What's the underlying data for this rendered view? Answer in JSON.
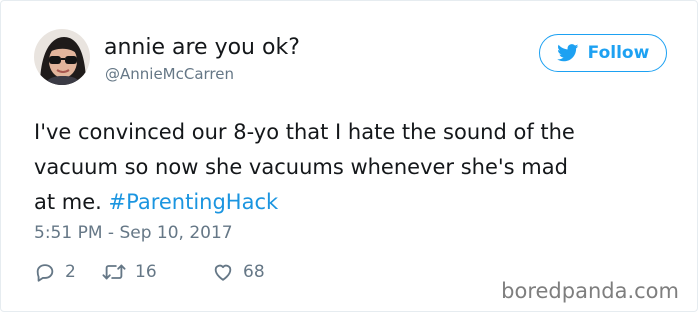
{
  "author": {
    "display_name": "annie are you ok?",
    "handle": "@AnnieMcCarren",
    "avatar_icon": "avatar-photo"
  },
  "follow": {
    "label": "Follow",
    "icon": "twitter-bird-icon",
    "color": "#1da1f2"
  },
  "tweet": {
    "line1": "I've convinced our 8-yo that I hate the sound of the",
    "line2": "vacuum so now she vacuums whenever she's mad",
    "line3_prefix": "at me. ",
    "hashtag": "#ParentingHack",
    "hashtag_color": "#1b95e0",
    "timestamp": "5:51 PM - Sep 10, 2017"
  },
  "actions": {
    "reply_count": "2",
    "retweet_count": "16",
    "like_count": "68",
    "reply_icon": "reply-icon",
    "retweet_icon": "retweet-icon",
    "like_icon": "heart-icon"
  },
  "watermark": {
    "text": "boredpanda.com"
  }
}
